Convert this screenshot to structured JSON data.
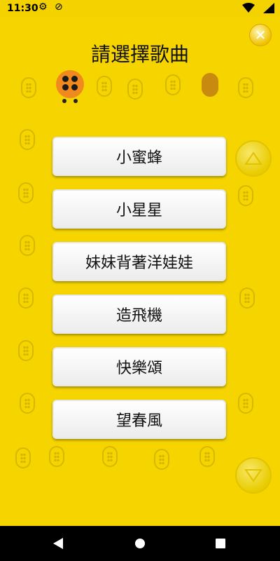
{
  "status_bar": {
    "time": "11:30",
    "icons": [
      "gear-icon",
      "at-icon",
      "wifi-icon",
      "battery-icon"
    ]
  },
  "screen": {
    "title": "請選擇歌曲"
  },
  "songs": [
    {
      "label": "小蜜蜂"
    },
    {
      "label": "小星星"
    },
    {
      "label": "妹妹背著洋娃娃"
    },
    {
      "label": "造飛機"
    },
    {
      "label": "快樂頌"
    },
    {
      "label": "望春風"
    }
  ],
  "colors": {
    "background": "#f5d400",
    "accent": "#f08a1e"
  },
  "navigation": {
    "buttons": [
      "back",
      "home",
      "recent-apps"
    ]
  }
}
